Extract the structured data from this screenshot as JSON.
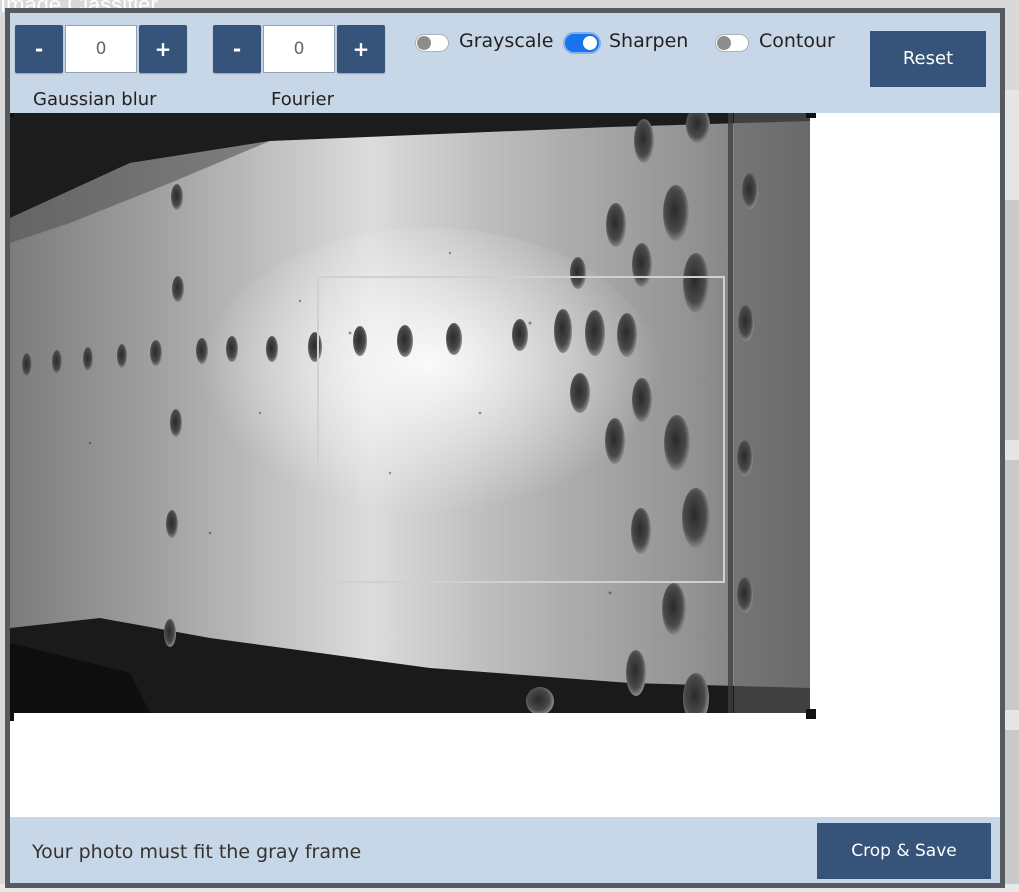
{
  "background": {
    "app_title": "Image Classifier"
  },
  "toolbar": {
    "gaussian": {
      "minus": "-",
      "value": "0",
      "plus": "+",
      "label": "Gaussian blur"
    },
    "fourier": {
      "minus": "-",
      "value": "0",
      "plus": "+",
      "label": "Fourier"
    },
    "toggles": [
      {
        "label": "Grayscale",
        "on": false
      },
      {
        "label": "Sharpen",
        "on": true
      },
      {
        "label": "Contour",
        "on": false
      }
    ],
    "reset_label": "Reset"
  },
  "footer": {
    "message": "Your photo must fit the gray frame",
    "crop_save_label": "Crop & Save"
  },
  "colors": {
    "toolbar_bg": "#c7d7e7",
    "button_bg": "#36537a",
    "toggle_on": "#1a73e8",
    "modal_border": "#555a5f"
  }
}
